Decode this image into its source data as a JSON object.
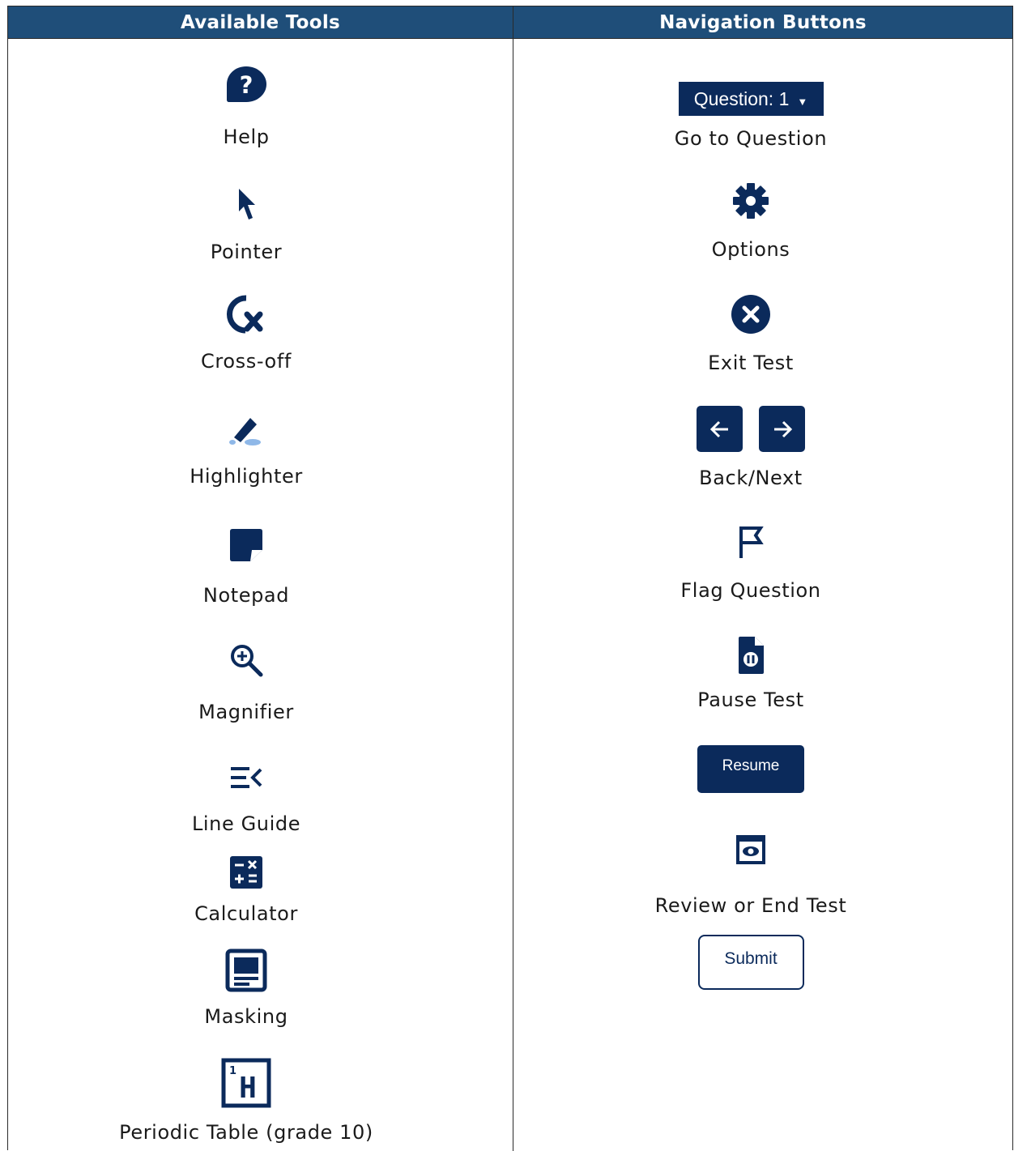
{
  "headers": {
    "left": "Available Tools",
    "right": "Navigation Buttons"
  },
  "tools": [
    {
      "icon": "help-icon",
      "label": "Help"
    },
    {
      "icon": "pointer-icon",
      "label": "Pointer"
    },
    {
      "icon": "cross-off-icon",
      "label": "Cross-off"
    },
    {
      "icon": "highlighter-icon",
      "label": "Highlighter"
    },
    {
      "icon": "notepad-icon",
      "label": "Notepad"
    },
    {
      "icon": "magnifier-icon",
      "label": "Magnifier"
    },
    {
      "icon": "line-guide-icon",
      "label": "Line Guide"
    },
    {
      "icon": "calculator-icon",
      "label": "Calculator"
    },
    {
      "icon": "masking-icon",
      "label": "Masking"
    },
    {
      "icon": "periodic-table-icon",
      "label": "Periodic Table (grade 10)"
    }
  ],
  "navigation": {
    "question_button": "Question: 1",
    "items": [
      {
        "label": "Go to Question"
      },
      {
        "icon": "gear-icon",
        "label": "Options"
      },
      {
        "icon": "close-icon",
        "label": "Exit Test"
      },
      {
        "icon": "arrow-icons",
        "label": "Back/Next"
      },
      {
        "icon": "flag-icon",
        "label": "Flag Question"
      },
      {
        "icon": "pause-icon",
        "label": "Pause Test"
      },
      {
        "icon": "review-icon",
        "label": "Review or End Test"
      }
    ],
    "resume_button": "Resume",
    "submit_button": "Submit",
    "periodic_symbol": "H",
    "periodic_number": "1"
  },
  "colors": {
    "header_bg": "#1f4e79",
    "icon_navy": "#0b2a5b",
    "highlight_blue": "#8fb8e8"
  }
}
